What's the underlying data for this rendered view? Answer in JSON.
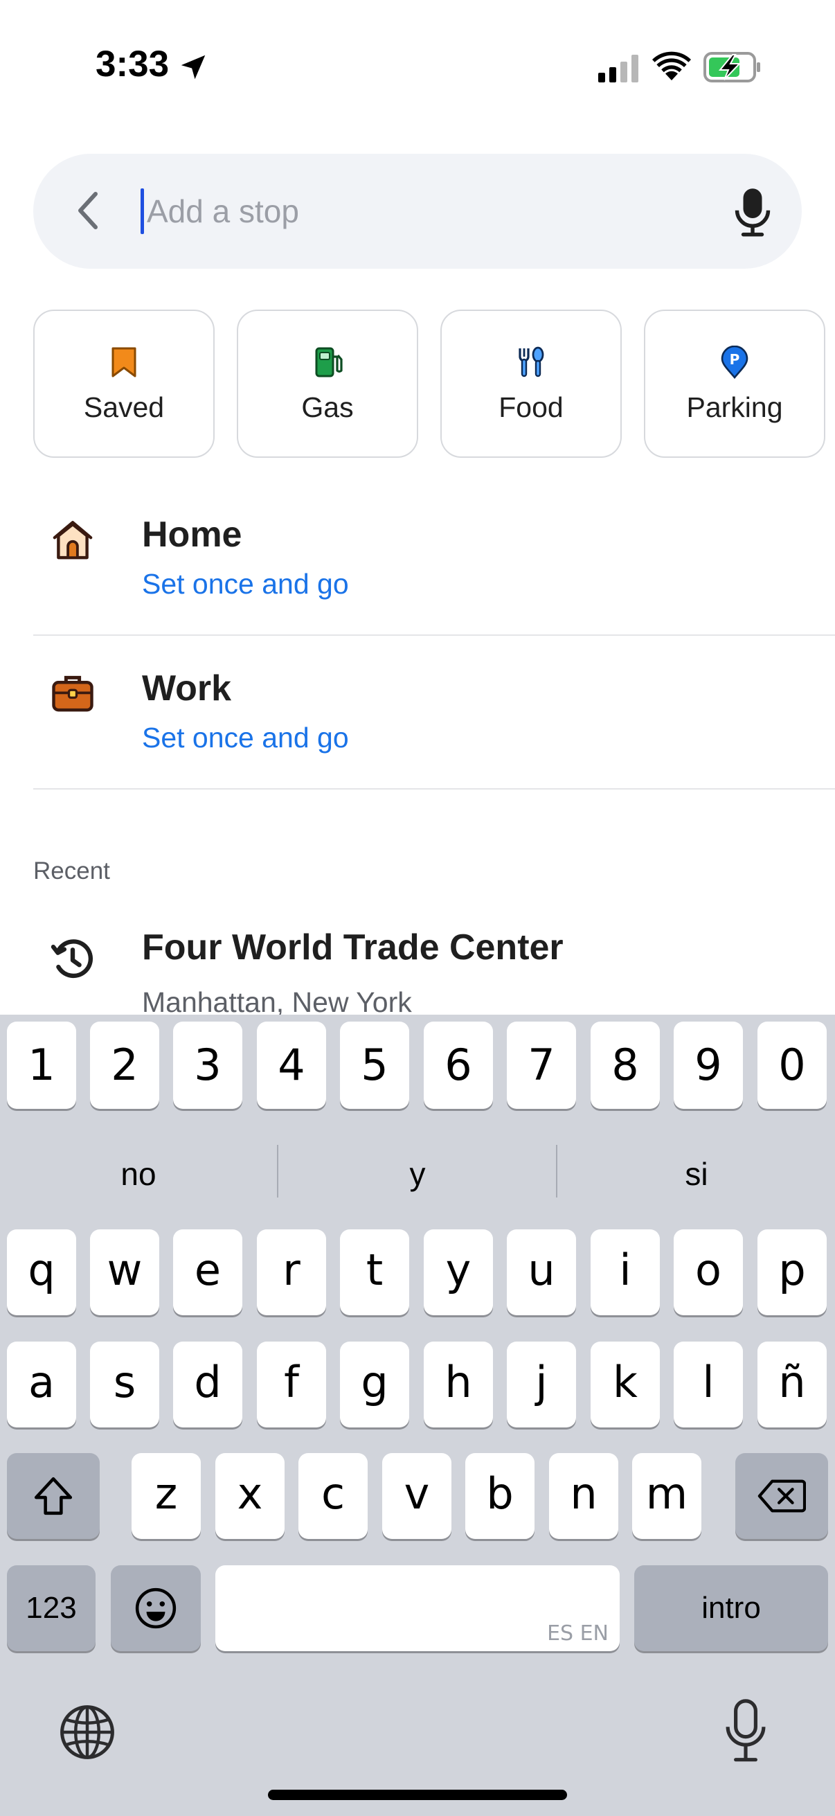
{
  "status_bar": {
    "time": "3:33"
  },
  "search": {
    "placeholder": "Add a stop",
    "value": ""
  },
  "chips": [
    {
      "label": "Saved",
      "icon": "bookmark-icon",
      "color": "#f28a1a"
    },
    {
      "label": "Gas",
      "icon": "gas-pump-icon",
      "color": "#1e9e4a"
    },
    {
      "label": "Food",
      "icon": "utensils-icon",
      "color": "#1a73e8"
    },
    {
      "label": "Parking",
      "icon": "parking-icon",
      "color": "#1a73e8"
    }
  ],
  "places": [
    {
      "title": "Home",
      "subtitle": "Set once and go",
      "icon": "home-icon"
    },
    {
      "title": "Work",
      "subtitle": "Set once and go",
      "icon": "briefcase-icon"
    }
  ],
  "recent": {
    "label": "Recent",
    "items": [
      {
        "title": "Four World Trade Center",
        "subtitle": "Manhattan, New York",
        "icon": "history-icon"
      }
    ]
  },
  "keyboard": {
    "number_row": [
      "1",
      "2",
      "3",
      "4",
      "5",
      "6",
      "7",
      "8",
      "9",
      "0"
    ],
    "suggestions": [
      "no",
      "y",
      "si"
    ],
    "row1": [
      "q",
      "w",
      "e",
      "r",
      "t",
      "y",
      "u",
      "i",
      "o",
      "p"
    ],
    "row2": [
      "a",
      "s",
      "d",
      "f",
      "g",
      "h",
      "j",
      "k",
      "l",
      "ñ"
    ],
    "row3": [
      "z",
      "x",
      "c",
      "v",
      "b",
      "n",
      "m"
    ],
    "mode_key": "123",
    "return_key": "intro",
    "space_hint": "ES EN"
  },
  "colors": {
    "accent": "#1a73e8",
    "search_bg": "#f1f3f7",
    "keyboard_bg": "#d1d4db"
  }
}
